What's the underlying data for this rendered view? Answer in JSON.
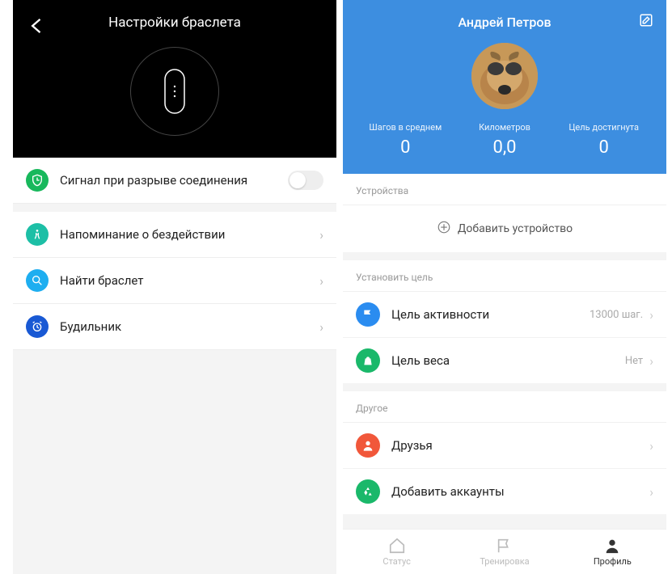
{
  "left": {
    "title": "Настройки браслета",
    "rows": {
      "disconnect": {
        "label": "Сигнал при разрыве соединения",
        "icon_bg": "#18b85c"
      },
      "idle": {
        "label": "Напоминание о бездействии",
        "icon_bg": "#1dbfa6"
      },
      "find": {
        "label": "Найти браслет",
        "icon_bg": "#1eaef0"
      },
      "alarm": {
        "label": "Будильник",
        "icon_bg": "#1959d4"
      }
    }
  },
  "right": {
    "user_name": "Андрей Петров",
    "stats": {
      "steps": {
        "label": "Шагов в среднем",
        "value": "0"
      },
      "km": {
        "label": "Километров",
        "value": "0,0"
      },
      "goal": {
        "label": "Цель достигнута",
        "value": "0"
      }
    },
    "sections": {
      "devices": {
        "title": "Устройства",
        "add_label": "Добавить устройство"
      },
      "goals": {
        "title": "Установить цель",
        "activity": {
          "label": "Цель активности",
          "value": "13000 шаг.",
          "icon_bg": "#2a8cf0"
        },
        "weight": {
          "label": "Цель веса",
          "value": "Нет",
          "icon_bg": "#1ab86a"
        }
      },
      "other": {
        "title": "Другое",
        "friends": {
          "label": "Друзья",
          "icon_bg": "#f1573a"
        },
        "accounts": {
          "label": "Добавить аккаунты",
          "icon_bg": "#1ab86a"
        }
      }
    },
    "tabs": {
      "status": "Статус",
      "workout": "Тренировка",
      "profile": "Профиль"
    }
  }
}
